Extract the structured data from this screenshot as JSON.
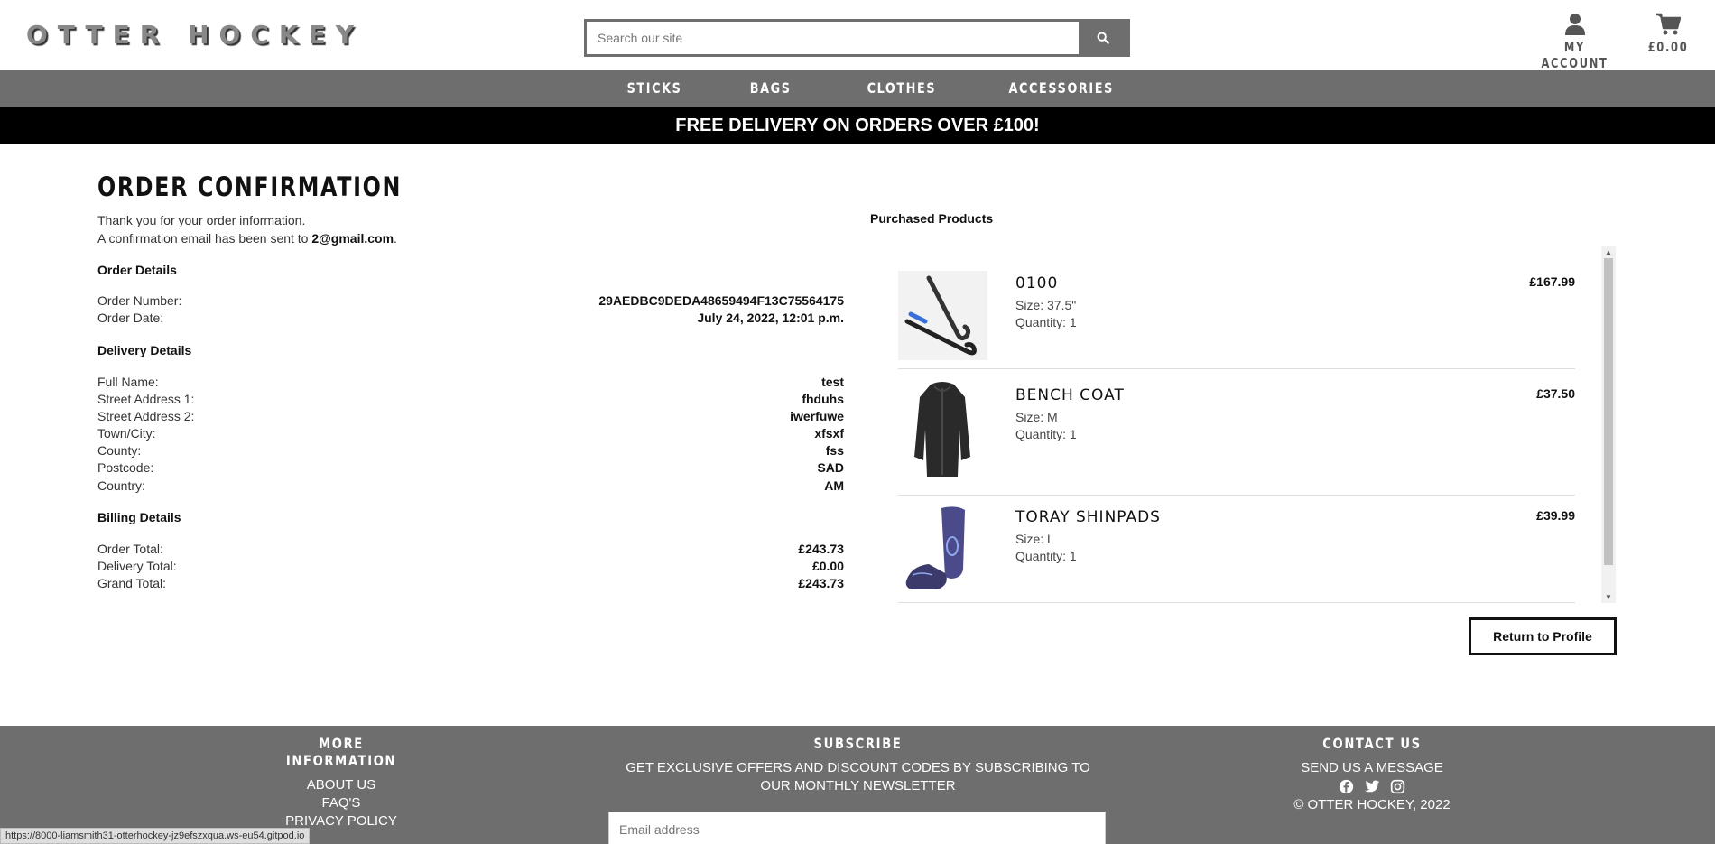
{
  "header": {
    "logo": "OTTER HOCKEY",
    "search_placeholder": "Search our site",
    "account_label": "MY ACCOUNT",
    "cart_total": "£0.00"
  },
  "nav": {
    "items": [
      "STICKS",
      "BAGS",
      "CLOTHES",
      "ACCESSORIES"
    ]
  },
  "banner": "FREE DELIVERY ON ORDERS OVER £100!",
  "order": {
    "title": "ORDER CONFIRMATION",
    "thanks": "Thank you for your order information.",
    "email_prefix": "A confirmation email has been sent to ",
    "email": "2@gmail.com",
    "email_suffix": ".",
    "order_details_h": "Order Details",
    "order_number_label": "Order Number:",
    "order_number": "29AEDBC9DEDA48659494F13C75564175",
    "order_date_label": "Order Date:",
    "order_date": "July 24, 2022, 12:01 p.m.",
    "delivery_h": "Delivery Details",
    "delivery": [
      {
        "label": "Full Name:",
        "value": "test"
      },
      {
        "label": "Street Address 1:",
        "value": "fhduhs"
      },
      {
        "label": "Street Address 2:",
        "value": "iwerfuwe"
      },
      {
        "label": "Town/City:",
        "value": "xfsxf"
      },
      {
        "label": "County:",
        "value": "fss"
      },
      {
        "label": "Postcode:",
        "value": "SAD"
      },
      {
        "label": "Country:",
        "value": "AM"
      }
    ],
    "billing_h": "Billing Details",
    "billing": [
      {
        "label": "Order Total:",
        "value": "£243.73"
      },
      {
        "label": "Delivery Total:",
        "value": "£0.00"
      },
      {
        "label": "Grand Total:",
        "value": "£243.73"
      }
    ]
  },
  "purchased": {
    "title": "Purchased Products",
    "products": [
      {
        "name": "0100",
        "size": "Size: 37.5\"",
        "qty": "Quantity: 1",
        "price": "£167.99",
        "image_icon": "hockey-stick-icon"
      },
      {
        "name": "BENCH COAT",
        "size": "Size: M",
        "qty": "Quantity: 1",
        "price": "£37.50",
        "image_icon": "coat-icon"
      },
      {
        "name": "TORAY SHINPADS",
        "size": "Size: L",
        "qty": "Quantity: 1",
        "price": "£39.99",
        "image_icon": "shinpad-icon"
      }
    ],
    "return_label": "Return to Profile"
  },
  "footer": {
    "more_h": "MORE INFORMATION",
    "more_links": [
      "ABOUT US",
      "FAQ'S",
      "PRIVACY POLICY"
    ],
    "subscribe_h": "SUBSCRIBE",
    "subscribe_text": "GET EXCLUSIVE OFFERS AND DISCOUNT CODES BY SUBSCRIBING TO OUR MONTHLY NEWSLETTER",
    "email_placeholder": "Email address",
    "contact_h": "CONTACT US",
    "contact_link": "SEND US A MESSAGE",
    "copyright": "© OTTER HOCKEY, 2022"
  },
  "status_url": "https://8000-liamsmith31-otterhockey-jz9efszxqua.ws-eu54.gitpod.io",
  "colors": {
    "nav_gray": "#6e6e6e",
    "banner_black": "#000000"
  }
}
